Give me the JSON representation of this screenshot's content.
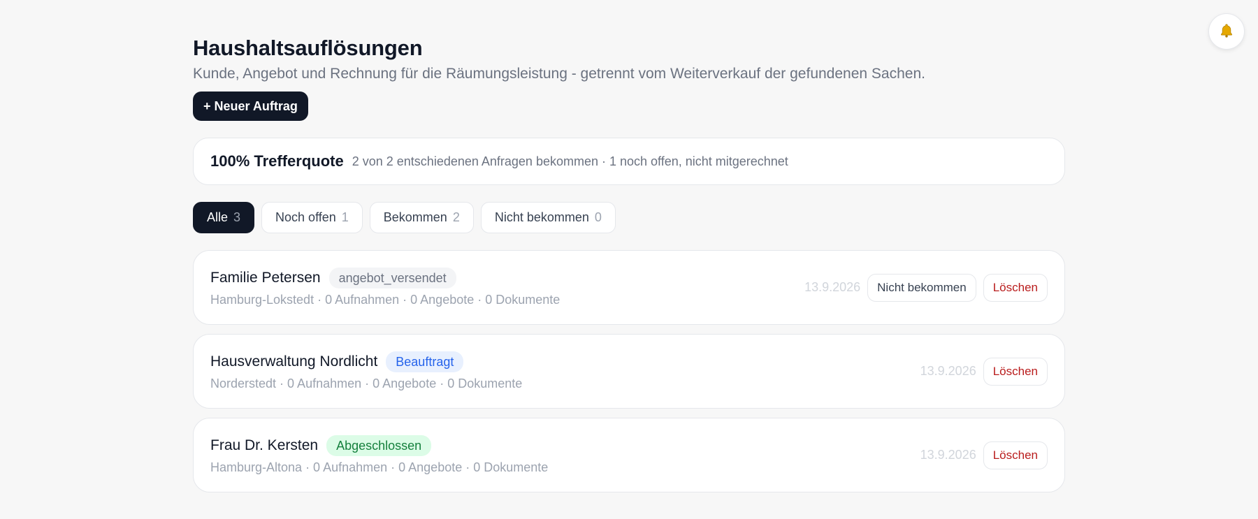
{
  "header": {
    "title": "Haushaltsauflösungen",
    "subtitle": "Kunde, Angebot und Rechnung für die Räumungsleistung - getrennt vom Weiterverkauf der gefundenen Sachen.",
    "new_button_label": "+ Neuer Auftrag"
  },
  "notifications": {
    "icon": "bell-icon",
    "color": "#e5a800"
  },
  "stats": {
    "rate": "100% Trefferquote",
    "description": "2 von 2 entschiedenen Anfragen bekommen · 1 noch offen, nicht mitgerechnet"
  },
  "filters": [
    {
      "label": "Alle",
      "count": "3",
      "active": true
    },
    {
      "label": "Noch offen",
      "count": "1",
      "active": false
    },
    {
      "label": "Bekommen",
      "count": "2",
      "active": false
    },
    {
      "label": "Nicht bekommen",
      "count": "0",
      "active": false
    }
  ],
  "orders": [
    {
      "name": "Familie Petersen",
      "status": "angebot_versendet",
      "status_color": "#6b7280",
      "meta": "Hamburg-Lokstedt · 0 Aufnahmen · 0 Angebote · 0 Dokumente",
      "date": "13.9.2026",
      "not_won_label": "Nicht bekommen",
      "delete_label": "Löschen"
    },
    {
      "name": "Hausverwaltung Nordlicht",
      "status": "Beauftragt",
      "status_color": "#2563eb",
      "meta": "Norderstedt · 0 Aufnahmen · 0 Angebote · 0 Dokumente",
      "date": "13.9.2026",
      "delete_label": "Löschen"
    },
    {
      "name": "Frau Dr. Kersten",
      "status": "Abgeschlossen",
      "status_color": "#15803d",
      "meta": "Hamburg-Altona · 0 Aufnahmen · 0 Angebote · 0 Dokumente",
      "date": "13.9.2026",
      "delete_label": "Löschen"
    }
  ],
  "colors": {
    "background": "#f7f7f7",
    "primary_dark": "#111827",
    "danger": "#b91c1c"
  }
}
